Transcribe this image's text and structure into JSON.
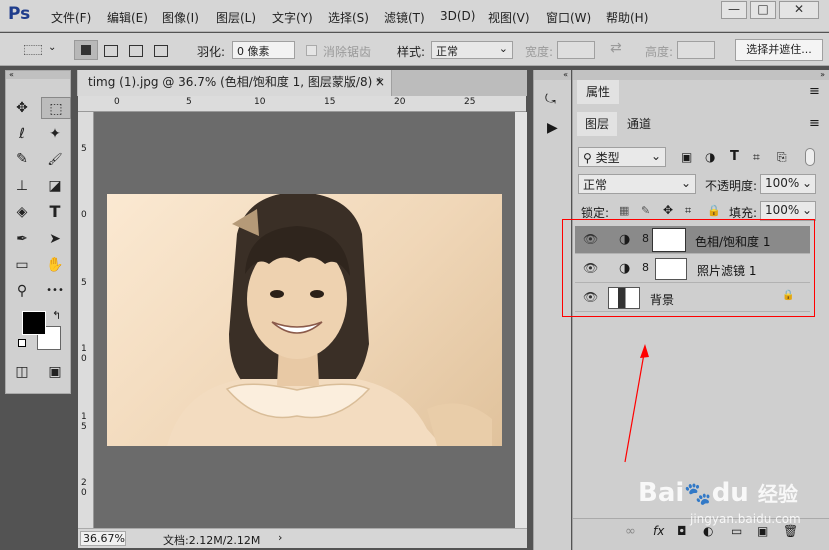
{
  "app": {
    "logo": "Ps"
  },
  "menu": [
    "文件(F)",
    "编辑(E)",
    "图像(I)",
    "图层(L)",
    "文字(Y)",
    "选择(S)",
    "滤镜(T)",
    "3D(D)",
    "视图(V)",
    "窗口(W)",
    "帮助(H)"
  ],
  "window_controls": {
    "minimize": "—",
    "restore": "□",
    "close": "✕"
  },
  "options": {
    "feather_label": "羽化:",
    "feather_value": "0 像素",
    "antialias_label": "消除锯齿",
    "style_label": "样式:",
    "style_value": "正常",
    "width_label": "宽度:",
    "height_label": "高度:",
    "select_mask_button": "选择并遮住..."
  },
  "document": {
    "tab_title": "timg (1).jpg @ 36.7% (色相/饱和度 1, 图层蒙版/8) *",
    "tab_close": "×",
    "zoom": "36.67%",
    "doc_info": "文档:2.12M/2.12M",
    "ruler_top_ticks": [
      "0",
      "5",
      "10",
      "15",
      "20",
      "25"
    ],
    "ruler_left_ticks": [
      "5",
      "0",
      "5",
      "1 0",
      "1 5",
      "2 0"
    ]
  },
  "tools": {
    "move": "✥",
    "marquee": "⬚",
    "lasso": "ℓ",
    "magic": "✦",
    "eyedropper": "✎",
    "brush": "🖌",
    "stamp": "⊥",
    "eraser": "◪",
    "blur": "◈",
    "type": "T",
    "pen": "✒",
    "path": "➤",
    "rect": "▭",
    "hand": "✋",
    "zoom": "⚲",
    "more": "•••",
    "swap": "↰",
    "mask": "◫",
    "screen": "▣"
  },
  "panels": {
    "properties_tab": "属性",
    "layers_tab": "图层",
    "channels_tab": "通道",
    "filter_kind": "类型",
    "blend_mode": "正常",
    "opacity_label": "不透明度:",
    "opacity_value": "100%",
    "lock_label": "锁定:",
    "fill_label": "填充:",
    "fill_value": "100%"
  },
  "layers": [
    {
      "name": "色相/饱和度 1",
      "selected": true
    },
    {
      "name": "照片滤镜 1",
      "selected": false
    },
    {
      "name": "背景",
      "selected": false
    }
  ],
  "icons": {
    "eye": "👁",
    "adjustment": "◑",
    "chain": "8",
    "lock": "🔒",
    "menu": "≡"
  },
  "bottom_icons": [
    "∞",
    "fx",
    "◘",
    "◐",
    "▭",
    "▣",
    "🗑"
  ],
  "watermark": {
    "brand": "Bai",
    "brand2": "du",
    "sub": "经验",
    "url": "jingyan.baidu.com"
  },
  "colors": {
    "annotation_red": "#ff0000",
    "selected_layer": "#8a8a8a"
  }
}
